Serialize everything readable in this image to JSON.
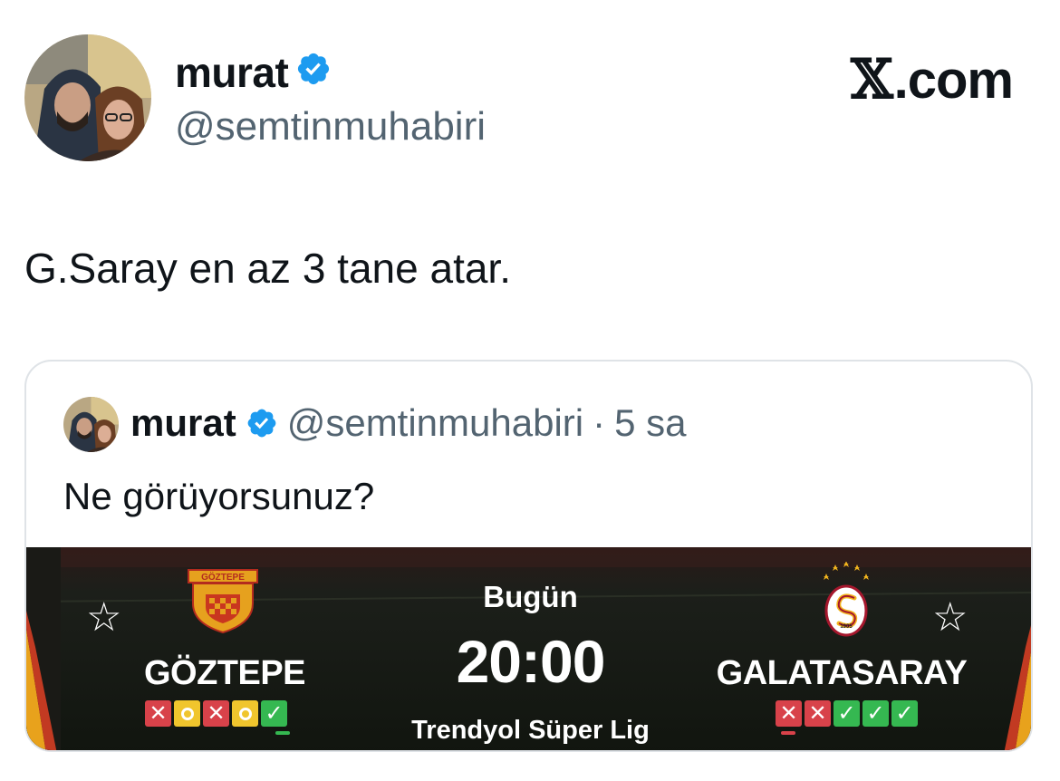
{
  "tweet": {
    "author": {
      "display_name": "murat",
      "handle": "@semtinmuhabiri",
      "verified": true
    },
    "brand": {
      "x_mark": "𝕏",
      "domain": ".com"
    },
    "text": "G.Saray en az 3 tane atar."
  },
  "quoted_tweet": {
    "author": {
      "display_name": "murat",
      "handle": "@semtinmuhabiri",
      "verified": true
    },
    "separator": "·",
    "time": "5 sa",
    "text": "Ne görüyorsunuz?",
    "match_card": {
      "day": "Bugün",
      "kickoff": "20:00",
      "league": "Trendyol Süper Lig",
      "home": {
        "name": "GÖZTEPE",
        "crest_text": "GÖZTEPE",
        "form": [
          "L",
          "D",
          "L",
          "D",
          "W"
        ],
        "star_icon": "star-outline-icon"
      },
      "away": {
        "name": "GALATASARAY",
        "crest_text": "1905",
        "form": [
          "L",
          "L",
          "W",
          "W",
          "W"
        ],
        "star_icon": "star-outline-icon"
      },
      "colors": {
        "win": "#35b851",
        "draw": "#f0c52d",
        "loss": "#d8424a",
        "background": "#151a16"
      }
    }
  },
  "colors": {
    "verified": "#1d9bf0",
    "secondary_text": "#536471",
    "primary_text": "#0f1419"
  }
}
